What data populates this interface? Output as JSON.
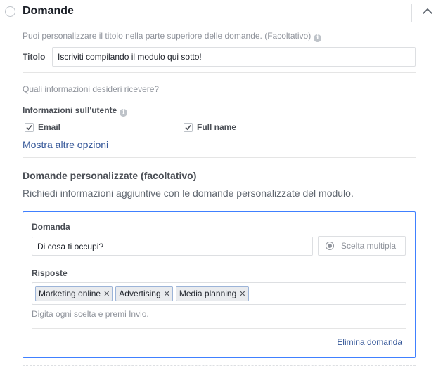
{
  "section": {
    "title": "Domande",
    "collapse_icon": "chevron-up-icon"
  },
  "title_block": {
    "hint": "Puoi personalizzare il titolo nella parte superiore delle domande. (Facoltativo)",
    "label": "Titolo",
    "value": "Iscriviti compilando il modulo qui sotto!"
  },
  "user_info": {
    "question": "Quali informazioni desideri ricevere?",
    "heading": "Informazioni sull'utente",
    "options": [
      {
        "label": "Email",
        "checked": true
      },
      {
        "label": "Full name",
        "checked": true
      }
    ],
    "more_link": "Mostra altre opzioni"
  },
  "custom_questions": {
    "heading": "Domande personalizzate (facoltativo)",
    "description": "Richiedi informazioni aggiuntive con le domande personalizzate del modulo.",
    "card": {
      "question_label": "Domanda",
      "question_value": "Di cosa ti occupi?",
      "type_button": "Scelta multipla",
      "answers_label": "Risposte",
      "answers": [
        "Marketing online",
        "Advertising",
        "Media planning"
      ],
      "answers_hint": "Digita ogni scelta e premi Invio.",
      "delete_link": "Elimina domanda"
    }
  },
  "colors": {
    "link": "#365899",
    "card_border": "#4080ff",
    "tag_bg": "#e9ebee",
    "tag_border": "#9cb4d8"
  }
}
